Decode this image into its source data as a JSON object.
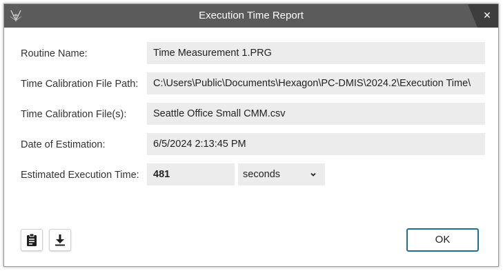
{
  "window": {
    "title": "Execution Time Report",
    "close_glyph": "✕"
  },
  "fields": {
    "routine_name": {
      "label": "Routine Name:",
      "value": "Time Measurement 1.PRG"
    },
    "calibration_path": {
      "label": "Time Calibration File Path:",
      "value": "C:\\Users\\Public\\Documents\\Hexagon\\PC-DMIS\\2024.2\\Execution Time\\"
    },
    "calibration_files": {
      "label": "Time Calibration File(s):",
      "value": "Seattle Office Small CMM.csv"
    },
    "estimation_date": {
      "label": "Date of Estimation:",
      "value": "6/5/2024 2:13:45 PM"
    },
    "execution_time": {
      "label": "Estimated Execution Time:",
      "value": "481",
      "unit": "seconds"
    }
  },
  "footer": {
    "copy_icon": "clipboard-icon",
    "save_icon": "download-icon",
    "ok_label": "OK"
  },
  "colors": {
    "titlebar": "#5b5b5b",
    "titlebar_dark": "#3d3d3d",
    "field_bg": "#ececec",
    "ok_border": "#1f6f8b"
  }
}
